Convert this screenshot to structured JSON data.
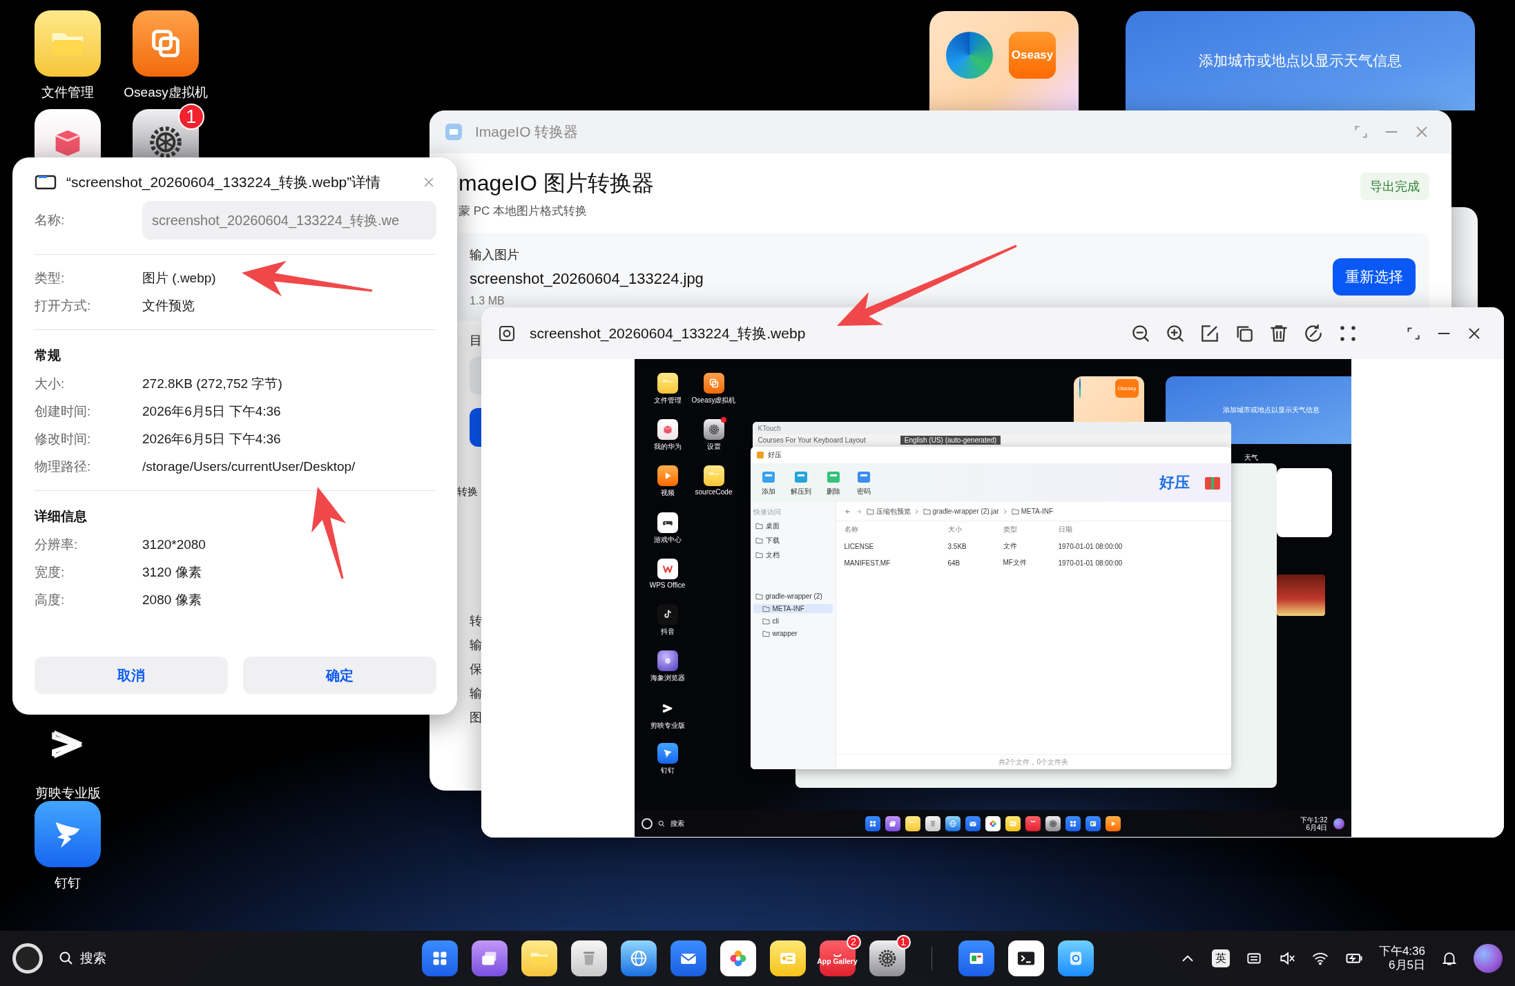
{
  "desktop": {
    "icons": [
      {
        "label": "文件管理",
        "kind": "folder"
      },
      {
        "label": "Oseasy虚拟机",
        "kind": "vm"
      },
      {
        "kind": "gift"
      },
      {
        "kind": "settings",
        "badge": "1"
      },
      {
        "label": "剪映专业版",
        "kind": "capcut"
      },
      {
        "label": "钉钉",
        "kind": "dingtalk"
      }
    ]
  },
  "folder_widget": {
    "store_label": "Oseasy"
  },
  "weather_widget": {
    "text": "添加城市或地点以显示天气信息"
  },
  "converter": {
    "title": "ImageIO 转换器",
    "heading": "mageIO 图片转换器",
    "subtitle": "蒙 PC 本地图片格式转换",
    "status": "导出完成",
    "input_label": "输入图片",
    "input_file": "screenshot_20260604_133224.jpg",
    "input_size": "1.3 MB",
    "reselect": "重新选择",
    "target_label": "目",
    "result_heading": "转换",
    "result_lines": [
      "转",
      "输",
      "保",
      "输",
      "图"
    ]
  },
  "viewer": {
    "title": "screenshot_20260604_133224_转换.webp",
    "screenshot": {
      "column_1": [
        {
          "label": "文件管理",
          "kind": "folder"
        },
        {
          "label": "我的华为",
          "kind": "gift"
        },
        {
          "label": "视频",
          "kind": "video"
        },
        {
          "label": "游戏中心",
          "kind": "game"
        },
        {
          "label": "WPS Office",
          "kind": "wps"
        },
        {
          "label": "抖音",
          "kind": "tiktok"
        },
        {
          "label": "海象浏览器",
          "kind": "walrus"
        },
        {
          "label": "剪映专业版",
          "kind": "capcut"
        },
        {
          "label": "钉钉",
          "kind": "dingtalk"
        }
      ],
      "column_2": [
        {
          "label": "Oseasy虚拟机",
          "kind": "vm"
        },
        {
          "label": "设置",
          "kind": "settings",
          "dot": true
        },
        {
          "label": "sourceCode",
          "kind": "folder"
        }
      ],
      "store_label": "Oseasy",
      "weather_text": "添加城市或地点以显示天气信息",
      "weather_label": "天气",
      "ktouch": {
        "title": "KTouch",
        "subtitle": "Courses For Your Keyboard Layout",
        "caption": "English (US) (auto-generated)"
      },
      "archiver": {
        "title": "好压",
        "tools": [
          "添加",
          "解压到",
          "删除",
          "密码"
        ],
        "brand": "好压",
        "sidebar_title": "快速访问",
        "places": [
          "桌面",
          "下载",
          "文档"
        ],
        "tree": {
          "label": "gradle-wrapper (2)",
          "children": [
            {
              "label": "META-INF",
              "selected": true
            },
            {
              "label": "cli",
              "selected": false
            },
            {
              "label": "wrapper",
              "selected": false
            }
          ]
        },
        "breadcrumb": [
          "压缩包预览",
          "gradle-wrapper (2).jar",
          "META-INF"
        ],
        "columns": [
          "名称",
          "大小",
          "类型",
          "日期"
        ],
        "rows": [
          [
            "LICENSE",
            "3.5KB",
            "文件",
            "1970-01-01 08:00:00"
          ],
          [
            "MANIFEST.MF",
            "64B",
            "MF文件",
            "1970-01-01 08:00:00"
          ]
        ],
        "footer": "共2个文件，0个文件夹"
      },
      "taskbar": {
        "search": "搜索",
        "time": "下午1:32",
        "date": "6月4日",
        "apps": [
          {
            "kind": "launcher"
          },
          {
            "kind": "multitask"
          },
          {
            "kind": "folder"
          },
          {
            "kind": "trash"
          },
          {
            "kind": "browser"
          },
          {
            "kind": "mail"
          },
          {
            "kind": "photos"
          },
          {
            "kind": "notes"
          },
          {
            "kind": "appgallery"
          },
          {
            "kind": "settings"
          },
          {
            "kind": "launcher"
          },
          {
            "kind": "office"
          },
          {
            "kind": "video"
          }
        ]
      }
    }
  },
  "details": {
    "title": "“screenshot_20260604_133224_转换.webp”详情",
    "name_label": "名称:",
    "name_value": "screenshot_20260604_133224_转换.we",
    "rows": [
      {
        "label": "类型:",
        "value": "图片 (.webp)"
      },
      {
        "label": "打开方式:",
        "value": "文件预览"
      }
    ],
    "sections": [
      {
        "title": "常规",
        "rows": [
          {
            "label": "大小:",
            "value": "272.8KB (272,752 字节)"
          },
          {
            "label": "创建时间:",
            "value": "2026年6月5日 下午4:36"
          },
          {
            "label": "修改时间:",
            "value": "2026年6月5日 下午4:36"
          },
          {
            "label": "物理路径:",
            "value": "/storage/Users/currentUser/Desktop/"
          }
        ]
      },
      {
        "title": "详细信息",
        "rows": [
          {
            "label": "分辨率:",
            "value": "3120*2080"
          },
          {
            "label": "宽度:",
            "value": "3120 像素"
          },
          {
            "label": "高度:",
            "value": "2080 像素"
          }
        ]
      }
    ],
    "buttons": [
      "取消",
      "确定"
    ]
  },
  "taskbar": {
    "search": "搜索",
    "apps": [
      {
        "kind": "launcher"
      },
      {
        "kind": "multitask"
      },
      {
        "kind": "folder"
      },
      {
        "kind": "trash"
      },
      {
        "kind": "browser"
      },
      {
        "kind": "mail"
      },
      {
        "kind": "photos"
      },
      {
        "kind": "notes"
      },
      {
        "kind": "appgallery",
        "label": "App Gallery",
        "badge": "2"
      },
      {
        "kind": "settings",
        "badge": "1"
      }
    ],
    "pinned": [
      {
        "kind": "office"
      },
      {
        "kind": "terminal"
      },
      {
        "kind": "imageio"
      }
    ],
    "ime": "英",
    "time": "下午4:36",
    "date": "6月5日"
  }
}
